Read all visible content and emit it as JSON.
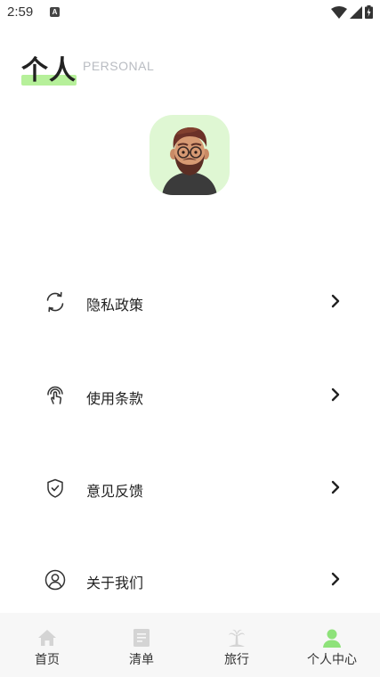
{
  "status_bar": {
    "time": "2:59",
    "badge": "A"
  },
  "header": {
    "title": "个人",
    "subtitle": "PERSONAL"
  },
  "menu": [
    {
      "label": "隐私政策",
      "icon": "refresh-icon"
    },
    {
      "label": "使用条款",
      "icon": "touch-icon"
    },
    {
      "label": "意见反馈",
      "icon": "shield-check-icon"
    },
    {
      "label": "关于我们",
      "icon": "user-circle-icon"
    }
  ],
  "nav": [
    {
      "label": "首页",
      "icon": "home-icon",
      "active": false
    },
    {
      "label": "清单",
      "icon": "list-icon",
      "active": false
    },
    {
      "label": "旅行",
      "icon": "palm-tree-icon",
      "active": false
    },
    {
      "label": "个人中心",
      "icon": "person-icon",
      "active": true
    }
  ],
  "colors": {
    "accent": "#8ee27a",
    "highlight": "#b6f09a",
    "avatar_bg": "#dff7d3",
    "inactive_icon": "#d4d4d4"
  }
}
